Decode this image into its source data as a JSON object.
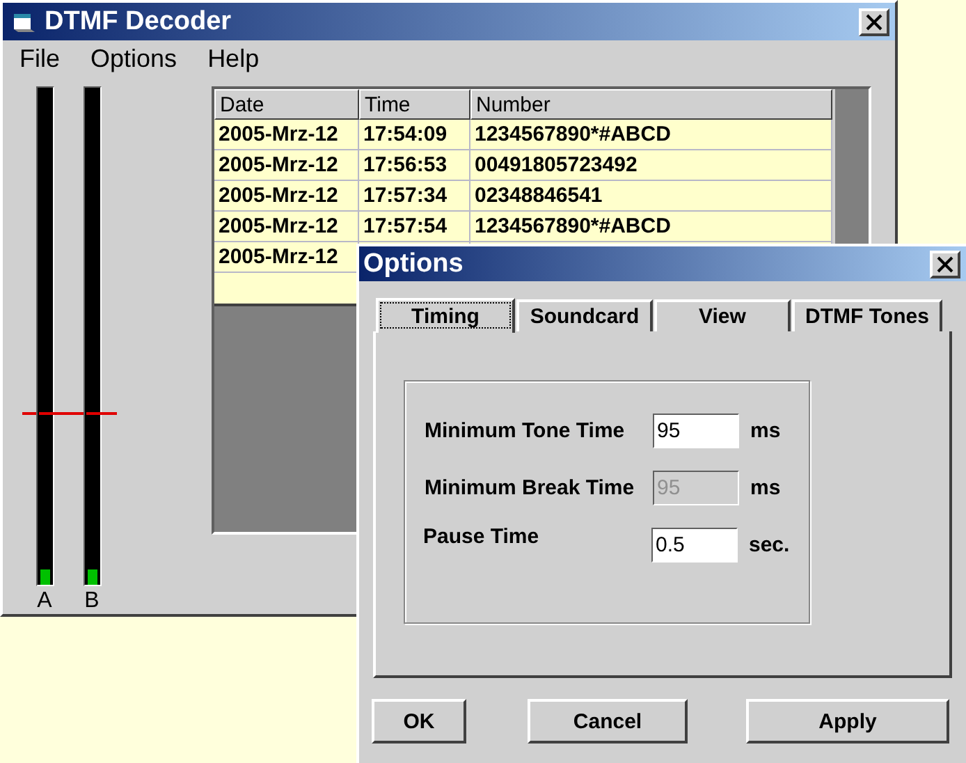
{
  "main_window": {
    "title": "DTMF Decoder",
    "menu": [
      "File",
      "Options",
      "Help"
    ],
    "meters": [
      {
        "label": "A",
        "level": 0.03
      },
      {
        "label": "B",
        "level": 0.03
      }
    ],
    "threshold": {
      "level": 0.34
    },
    "table": {
      "columns": [
        "Date",
        "Time",
        "Number"
      ],
      "rows": [
        {
          "date": "2005-Mrz-12",
          "time": "17:54:09",
          "number": "1234567890*#ABCD"
        },
        {
          "date": "2005-Mrz-12",
          "time": "17:56:53",
          "number": "00491805723492"
        },
        {
          "date": "2005-Mrz-12",
          "time": "17:57:34",
          "number": "02348846541"
        },
        {
          "date": "2005-Mrz-12",
          "time": "17:57:54",
          "number": "1234567890*#ABCD"
        },
        {
          "date": "2005-Mrz-12"
        }
      ]
    }
  },
  "dialog": {
    "title": "Options",
    "tabs": [
      {
        "label": "Timing",
        "selected": true
      },
      {
        "label": "Soundcard",
        "selected": false
      },
      {
        "label": "View",
        "selected": false
      },
      {
        "label": "DTMF Tones",
        "selected": false
      }
    ],
    "fields": [
      {
        "label": "Minimum Tone Time",
        "value": "95",
        "unit": "ms",
        "disabled": false
      },
      {
        "label": "Minimum Break Time",
        "value": "95",
        "unit": "ms",
        "disabled": true
      },
      {
        "label": "Pause Time",
        "value": "0.5",
        "unit": "sec.",
        "disabled": false
      }
    ],
    "buttons": [
      "OK",
      "Cancel",
      "Apply"
    ]
  }
}
